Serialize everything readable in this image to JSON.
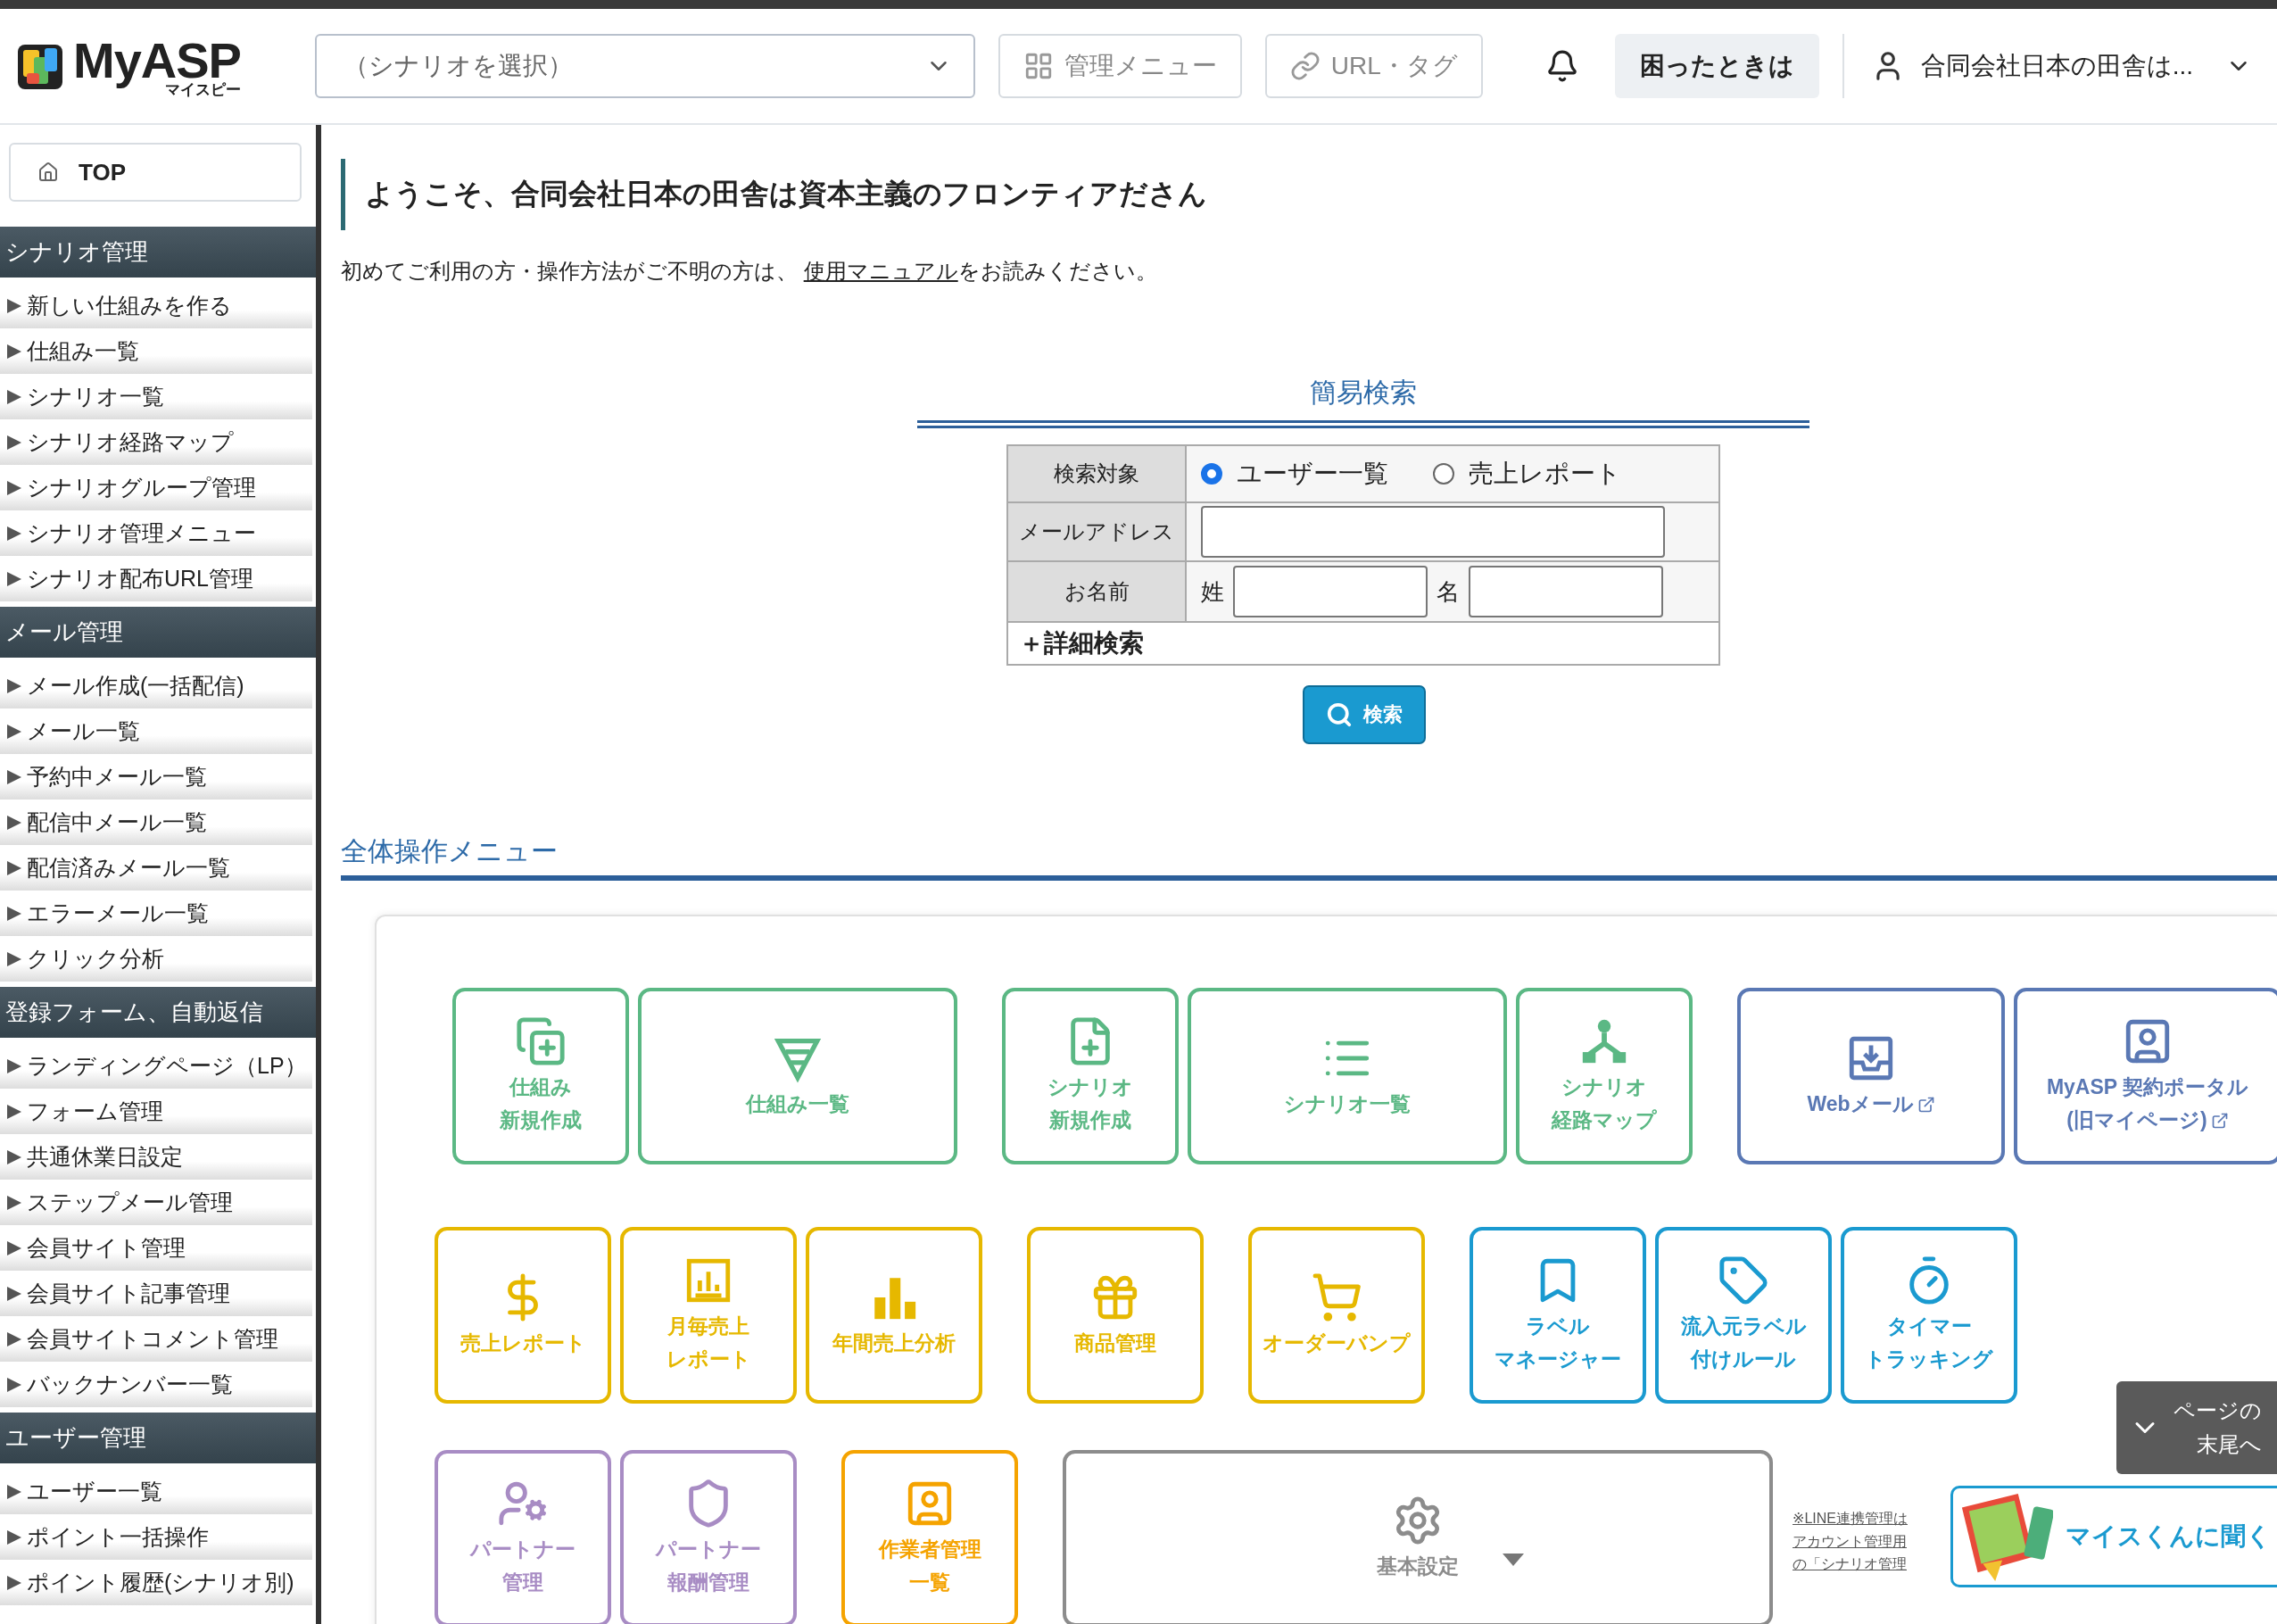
{
  "header": {
    "logo": {
      "name": "MyASP",
      "kana": "マイスピー"
    },
    "scenario_select": {
      "placeholder": "（シナリオを選択）"
    },
    "buttons": [
      {
        "kind": "grid",
        "label": "管理メニュー"
      },
      {
        "kind": "link",
        "label": "URL・タグ"
      }
    ],
    "help": "困ったときは",
    "user": "合同会社日本の田舎は..."
  },
  "sidebar": {
    "top": "TOP",
    "sections": [
      {
        "title": "シナリオ管理",
        "items": [
          "新しい仕組みを作る",
          "仕組み一覧",
          "シナリオ一覧",
          "シナリオ経路マップ",
          "シナリオグループ管理",
          "シナリオ管理メニュー",
          "シナリオ配布URL管理"
        ]
      },
      {
        "title": "メール管理",
        "items": [
          "メール作成(一括配信)",
          "メール一覧",
          "予約中メール一覧",
          "配信中メール一覧",
          "配信済みメール一覧",
          "エラーメール一覧",
          "クリック分析"
        ]
      },
      {
        "title": "登録フォーム、自動返信",
        "items": [
          "ランディングページ（LP）",
          "フォーム管理",
          "共通休業日設定",
          "ステップメール管理",
          "会員サイト管理",
          "会員サイト記事管理",
          "会員サイトコメント管理",
          "バックナンバー一覧"
        ]
      },
      {
        "title": "ユーザー管理",
        "items": [
          "ユーザー一覧",
          "ポイント一括操作",
          "ポイント履歴(シナリオ別)"
        ]
      }
    ]
  },
  "welcome": {
    "title": "ようこそ、合同会社日本の田舎は資本主義のフロンティアださん",
    "intro": {
      "before": "初めてご利用の方・操作方法がご不明の方は、 ",
      "link": "使用マニュアル",
      "after": "をお読みください。"
    }
  },
  "search": {
    "title": "簡易検索",
    "rows": [
      {
        "kind": "radio",
        "label": "検索対象",
        "options": [
          {
            "label": "ユーザー一覧",
            "selected": true
          },
          {
            "label": "売上レポート",
            "selected": false
          }
        ]
      },
      {
        "kind": "text",
        "label": "メールアドレス"
      },
      {
        "kind": "name",
        "label": "お名前",
        "parts": [
          "姓",
          "名"
        ]
      }
    ],
    "advanced": "＋詳細検索",
    "button": "検索"
  },
  "menu": {
    "title": "全体操作メニュー",
    "rows": [
      [
        [
          {
            "label": [
              "仕組み",
              "新規作成"
            ],
            "color": "#5bb884"
          },
          {
            "label": [
              "仕組み一覧"
            ],
            "color": "#5bb884"
          }
        ],
        [
          {
            "label": [
              "シナリオ",
              "新規作成"
            ],
            "color": "#5bb884"
          },
          {
            "label": [
              "シナリオ一覧"
            ],
            "color": "#5bb884"
          },
          {
            "label": [
              "シナリオ",
              "経路マップ"
            ],
            "color": "#5bb884"
          }
        ],
        [
          {
            "label": [
              "Webメール"
            ],
            "color": "#5a78b4",
            "external": true
          },
          {
            "label": [
              "MyASP 契約ポータル",
              "(旧マイページ)"
            ],
            "color": "#5a78b4",
            "external": true
          }
        ]
      ],
      [
        [
          {
            "label": [
              "売上レポート"
            ],
            "color": "#e6b800"
          },
          {
            "label": [
              "月毎売上",
              "レポート"
            ],
            "color": "#e6b800"
          },
          {
            "label": [
              "年間売上分析"
            ],
            "color": "#e6b800"
          }
        ],
        [
          {
            "label": [
              "商品管理"
            ],
            "color": "#e6b800"
          }
        ],
        [
          {
            "label": [
              "オーダーバンプ"
            ],
            "color": "#e6b800"
          }
        ],
        [
          {
            "label": [
              "ラベル",
              "マネージャー"
            ],
            "color": "#1a9ad0"
          },
          {
            "label": [
              "流入元ラベル",
              "付けルール"
            ],
            "color": "#1a9ad0"
          },
          {
            "label": [
              "タイマー",
              "トラッキング"
            ],
            "color": "#1a9ad0"
          }
        ]
      ],
      [
        [
          {
            "label": [
              "パートナー",
              "管理"
            ],
            "color": "#a88cc4"
          },
          {
            "label": [
              "パートナー",
              "報酬管理"
            ],
            "color": "#a88cc4"
          }
        ],
        [
          {
            "label": [
              "作業者管理",
              "一覧"
            ],
            "color": "#f5a300"
          }
        ],
        [
          {
            "label": [
              "基本設定"
            ],
            "color": "#8c8c8c"
          }
        ]
      ]
    ],
    "note": [
      "※LINE連携管理は",
      "アカウント管理用",
      "の「シナリオ管理"
    ]
  },
  "float": {
    "scroll": [
      "ページの",
      "末尾へ"
    ],
    "assistant": "マイスくんに聞く"
  }
}
